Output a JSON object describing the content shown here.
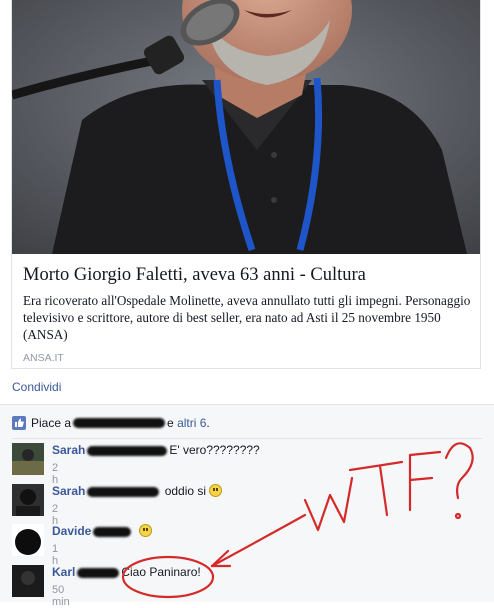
{
  "link_preview": {
    "title": "Morto Giorgio Faletti, aveva 63 anni - Cultura",
    "description": "Era ricoverato all'Ospedale Molinette, aveva annullato tutti gli impegni. Personaggio televisivo e scrittore, autore di best seller, era nato ad Asti il 25 novembre 1950 (ANSA)",
    "source": "ANSA.IT"
  },
  "actions": {
    "share_label": "Condividi"
  },
  "likes": {
    "prefix": "Piace a",
    "and": "e",
    "others": "altri 6",
    "suffix": "."
  },
  "comments": [
    {
      "author": "Sarah",
      "text": "E' vero????????",
      "time": "2 h",
      "emoji": ""
    },
    {
      "author": "Sarah",
      "text": "oddio si",
      "time": "2 h",
      "emoji": "smile-emoji"
    },
    {
      "author": "Davide",
      "text": "",
      "time": "1 h",
      "emoji": "smile-emoji"
    },
    {
      "author": "Karl",
      "text": "Ciao Paninaro!",
      "time": "50 min",
      "emoji": ""
    }
  ],
  "annotation": {
    "text": "WTF?",
    "color": "#d42a2a"
  },
  "colors": {
    "link": "#3b5998",
    "meta": "#9197a3",
    "likes_bg": "#f6f7f8"
  }
}
